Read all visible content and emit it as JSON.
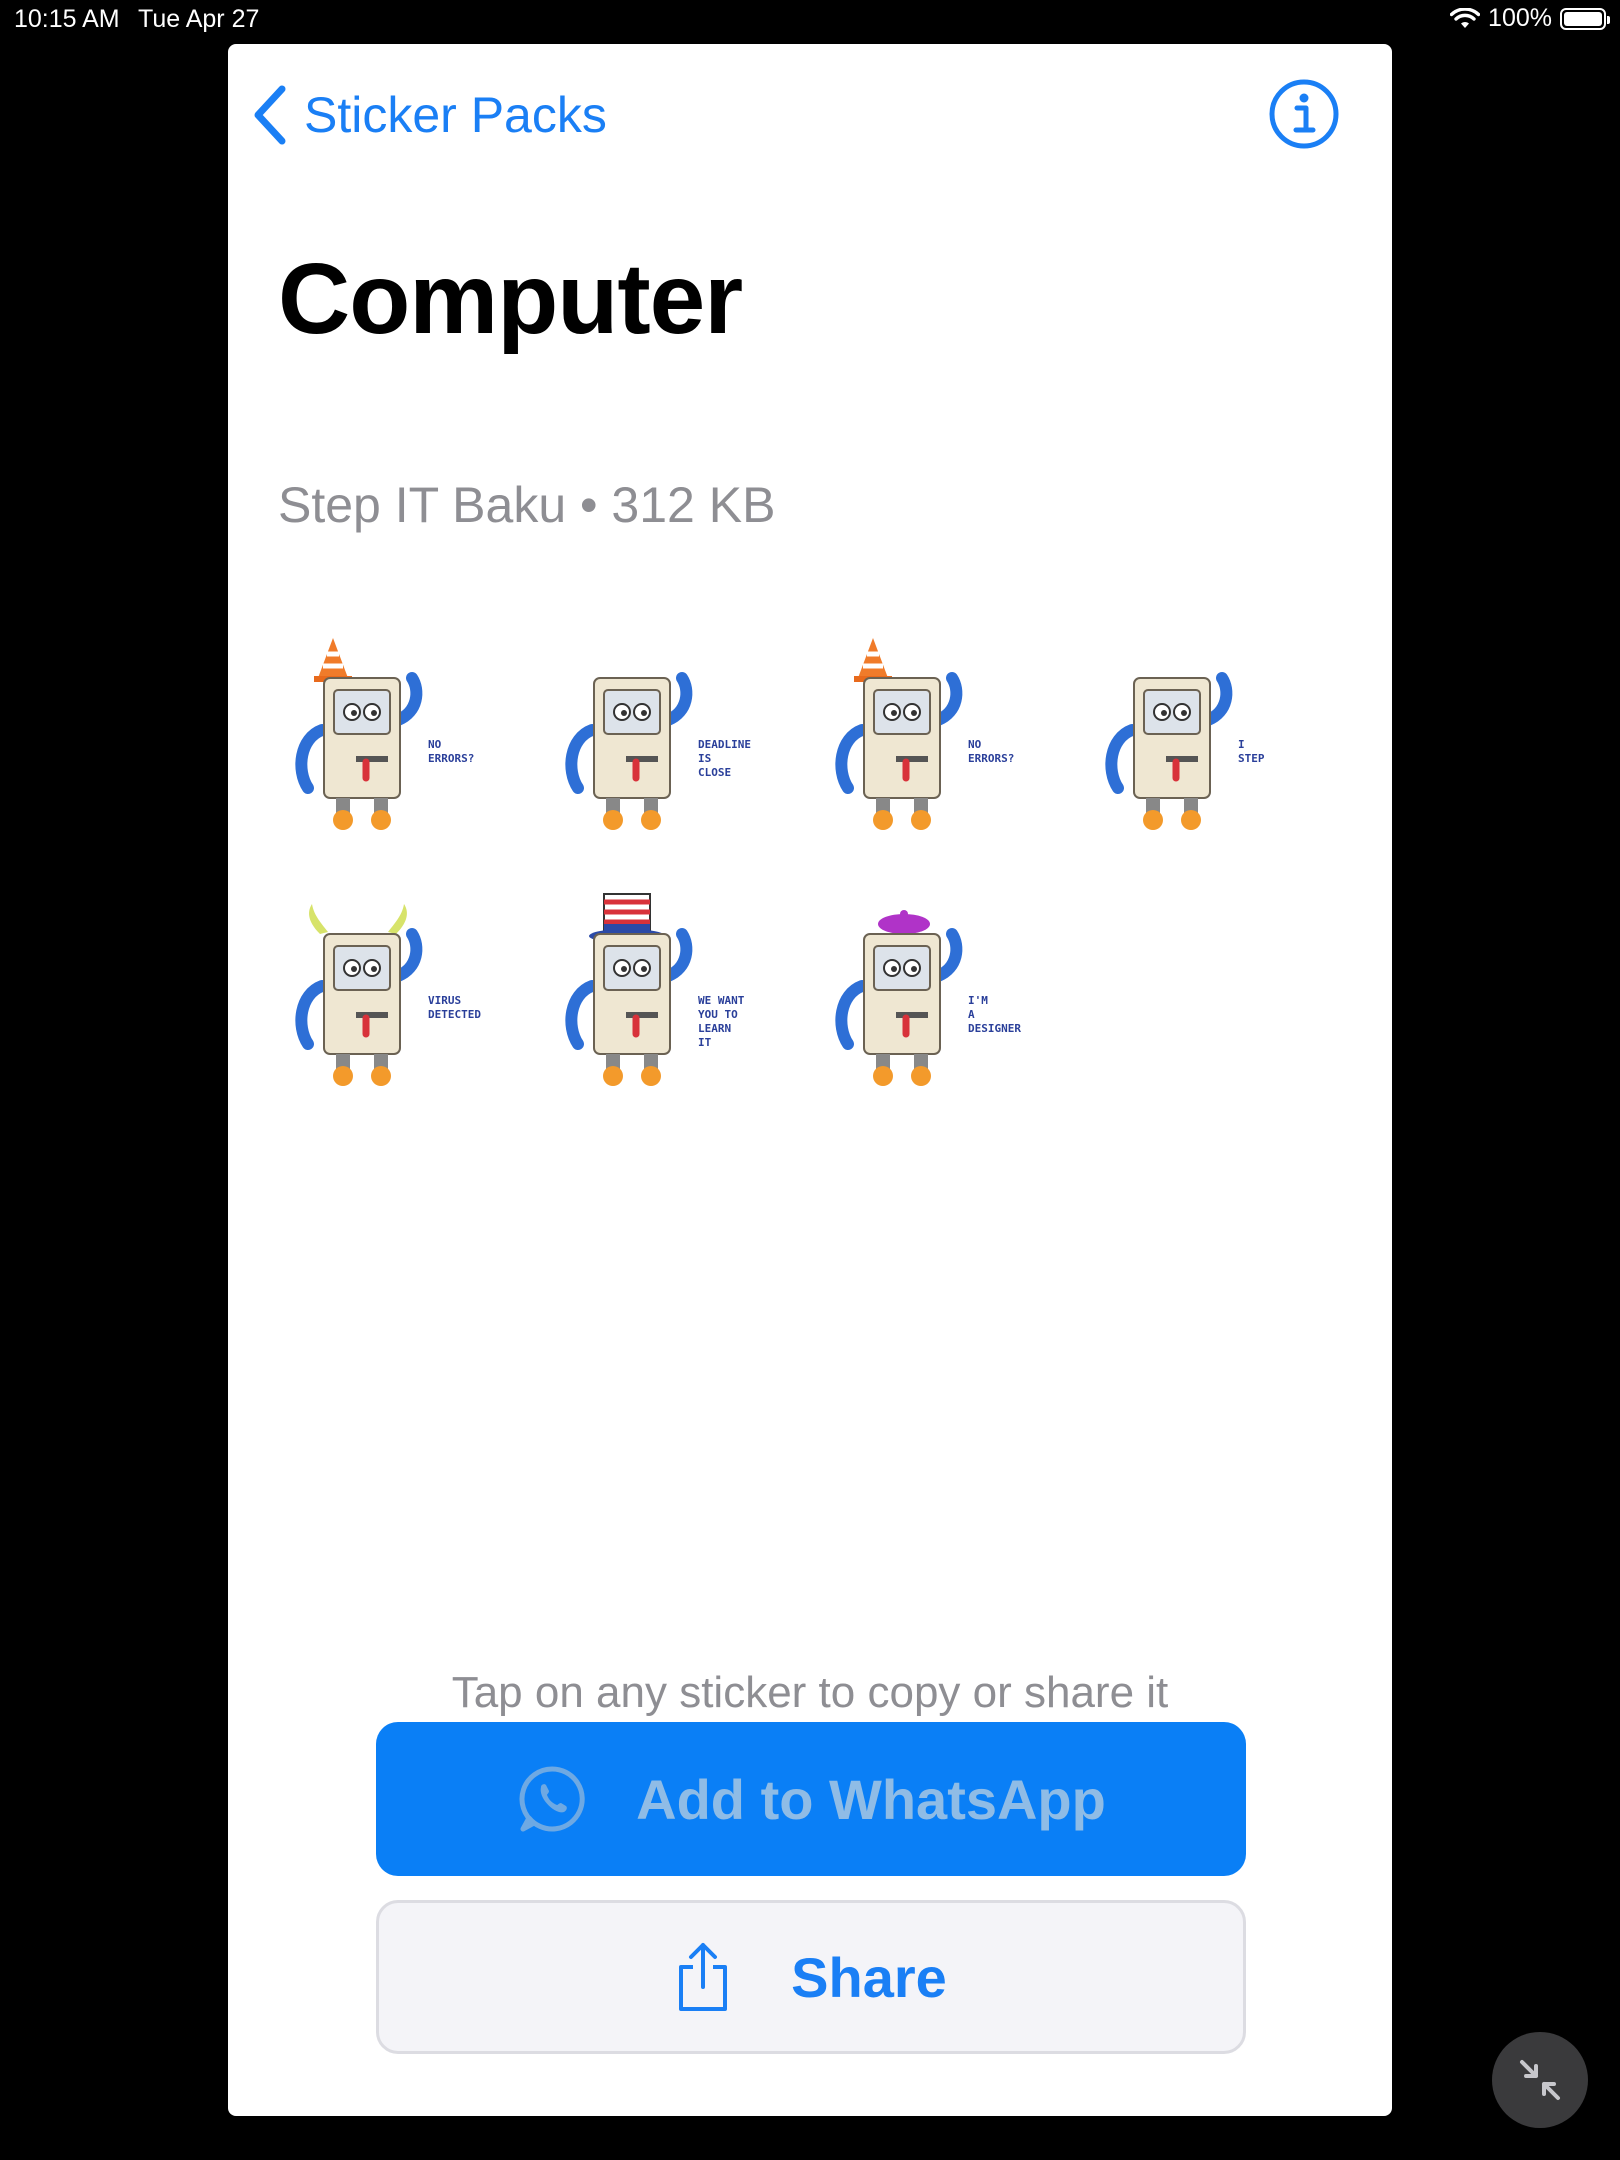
{
  "status_bar": {
    "time": "10:15 AM",
    "date": "Tue Apr 27",
    "battery": "100%",
    "wifi_icon": "wifi-icon",
    "battery_icon": "battery-icon"
  },
  "nav": {
    "back_label": "Sticker Packs",
    "back_icon": "chevron-left-icon",
    "info_icon": "info-icon"
  },
  "pack": {
    "title": "Computer",
    "subtitle": "Step IT Baku • 312 KB"
  },
  "stickers": [
    {
      "name": "sticker-no-errors-cone",
      "hat": "cone",
      "caption": [
        "NO",
        "ERRORS?"
      ]
    },
    {
      "name": "sticker-deadline",
      "hat": "none",
      "caption": [
        "DEADLINE",
        "IS",
        "CLOSE"
      ]
    },
    {
      "name": "sticker-no-errors-cone-2",
      "hat": "cone",
      "caption": [
        "NO",
        "ERRORS?"
      ]
    },
    {
      "name": "sticker-i-love-step",
      "hat": "none",
      "caption": [
        "I",
        "STEP"
      ]
    },
    {
      "name": "sticker-virus-detected",
      "hat": "horns",
      "caption": [
        "VIRUS",
        "DETECTED"
      ]
    },
    {
      "name": "sticker-we-want-you",
      "hat": "uncle-sam",
      "caption": [
        "WE WANT",
        "YOU TO",
        "LEARN",
        "IT"
      ]
    },
    {
      "name": "sticker-designer",
      "hat": "beret",
      "caption": [
        "I'M",
        "A",
        "DESIGNER"
      ]
    }
  ],
  "hint": "Tap on any sticker to copy or share it",
  "buttons": {
    "add_label": "Add to WhatsApp",
    "add_icon": "whatsapp-icon",
    "share_label": "Share",
    "share_icon": "share-icon"
  },
  "minimize_icon": "minimize-arrows-icon",
  "colors": {
    "accent": "#1a7ff5",
    "add_button": "#0a7ff6",
    "secondary_text": "#8e8e93"
  }
}
